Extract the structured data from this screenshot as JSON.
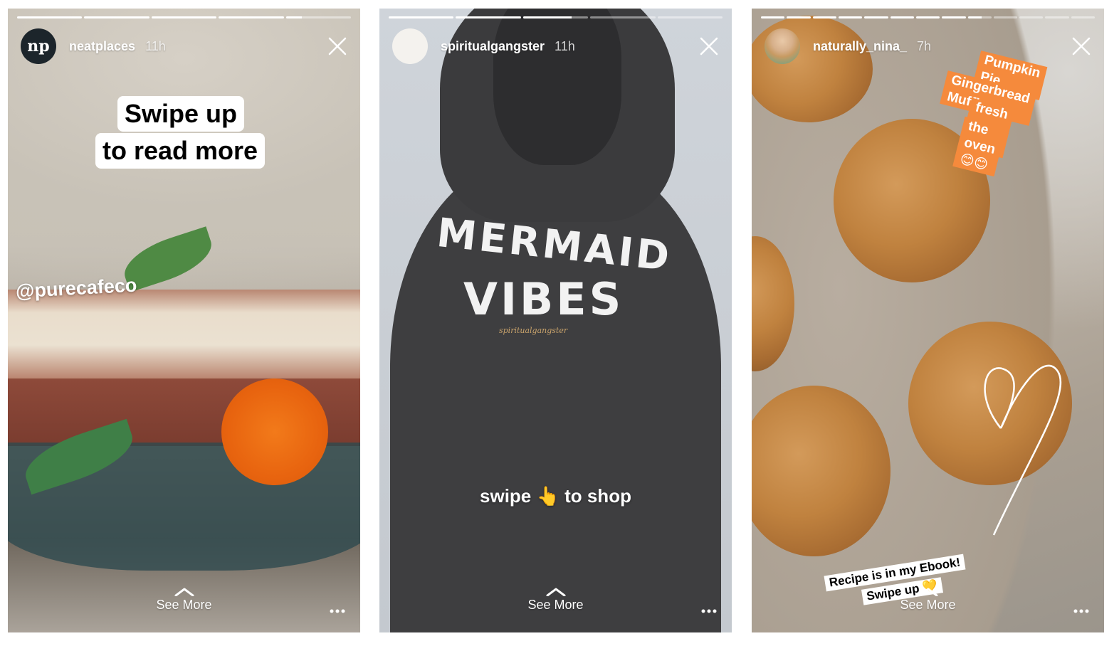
{
  "stories": [
    {
      "username": "neatplaces",
      "time": "11h",
      "avatar_text": "np",
      "progress": [
        1,
        1,
        1,
        1,
        0.25
      ],
      "caption_line1": "Swipe up",
      "caption_line2": "to read more",
      "mention": "@purecafeco",
      "see_more": "See More"
    },
    {
      "username": "spiritualgangster",
      "time": "11h",
      "progress": [
        1,
        1,
        0.75,
        0,
        0
      ],
      "print_line1": "MERMAID",
      "print_line2": "VIBES",
      "caption": "swipe 👆 to shop",
      "see_more": "See More"
    },
    {
      "username": "naturally_nina_",
      "time": "7h",
      "progress": [
        1,
        1,
        1,
        1,
        1,
        1,
        1,
        1,
        0.6,
        0,
        0,
        0,
        0
      ],
      "label_lines": [
        "Pumpkin Pie",
        "Gingerbread Muffins",
        "fresh out of",
        "the oven 😊😊"
      ],
      "recipe_line1": "Recipe is in my Ebook!",
      "recipe_line2": "Swipe up 💛",
      "see_more": "See More"
    }
  ],
  "colors": {
    "orange_label": "#f58a3c",
    "avatar_dark": "#1c252b"
  }
}
